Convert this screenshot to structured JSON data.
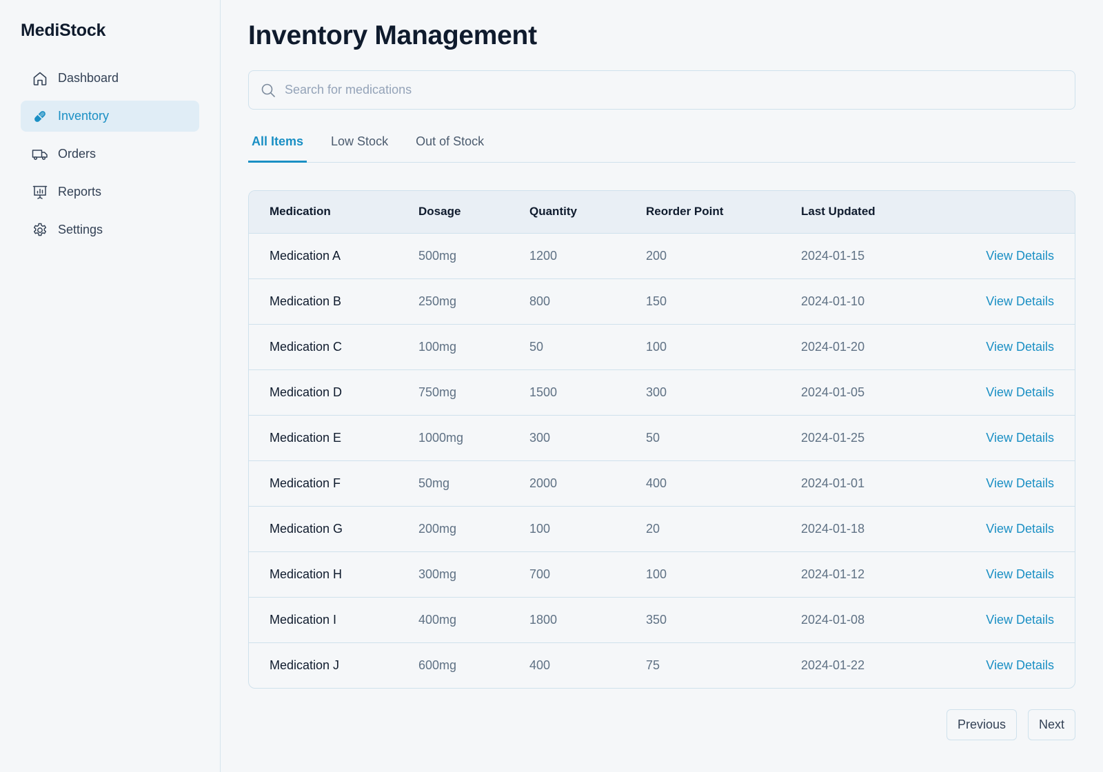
{
  "app": {
    "name": "MediStock"
  },
  "sidebar": {
    "items": [
      {
        "label": "Dashboard",
        "icon": "home-icon",
        "active": false
      },
      {
        "label": "Inventory",
        "icon": "pill-icon",
        "active": true
      },
      {
        "label": "Orders",
        "icon": "truck-icon",
        "active": false
      },
      {
        "label": "Reports",
        "icon": "presentation-chart-icon",
        "active": false
      },
      {
        "label": "Settings",
        "icon": "gear-icon",
        "active": false
      }
    ]
  },
  "main": {
    "title": "Inventory Management",
    "search": {
      "placeholder": "Search for medications",
      "value": ""
    },
    "tabs": [
      {
        "label": "All Items",
        "active": true
      },
      {
        "label": "Low Stock",
        "active": false
      },
      {
        "label": "Out of Stock",
        "active": false
      }
    ],
    "table": {
      "columns": [
        "Medication",
        "Dosage",
        "Quantity",
        "Reorder Point",
        "Last Updated",
        ""
      ],
      "rows": [
        {
          "medication": "Medication A",
          "dosage": "500mg",
          "quantity": "1200",
          "reorder": "200",
          "updated": "2024-01-15",
          "action": "View Details"
        },
        {
          "medication": "Medication B",
          "dosage": "250mg",
          "quantity": "800",
          "reorder": "150",
          "updated": "2024-01-10",
          "action": "View Details"
        },
        {
          "medication": "Medication C",
          "dosage": "100mg",
          "quantity": "50",
          "reorder": "100",
          "updated": "2024-01-20",
          "action": "View Details"
        },
        {
          "medication": "Medication D",
          "dosage": "750mg",
          "quantity": "1500",
          "reorder": "300",
          "updated": "2024-01-05",
          "action": "View Details"
        },
        {
          "medication": "Medication E",
          "dosage": "1000mg",
          "quantity": "300",
          "reorder": "50",
          "updated": "2024-01-25",
          "action": "View Details"
        },
        {
          "medication": "Medication F",
          "dosage": "50mg",
          "quantity": "2000",
          "reorder": "400",
          "updated": "2024-01-01",
          "action": "View Details"
        },
        {
          "medication": "Medication G",
          "dosage": "200mg",
          "quantity": "100",
          "reorder": "20",
          "updated": "2024-01-18",
          "action": "View Details"
        },
        {
          "medication": "Medication H",
          "dosage": "300mg",
          "quantity": "700",
          "reorder": "100",
          "updated": "2024-01-12",
          "action": "View Details"
        },
        {
          "medication": "Medication I",
          "dosage": "400mg",
          "quantity": "1800",
          "reorder": "350",
          "updated": "2024-01-08",
          "action": "View Details"
        },
        {
          "medication": "Medication J",
          "dosage": "600mg",
          "quantity": "400",
          "reorder": "75",
          "updated": "2024-01-22",
          "action": "View Details"
        }
      ]
    },
    "pagination": {
      "previous_label": "Previous",
      "next_label": "Next"
    }
  },
  "colors": {
    "accent": "#1a8fc4",
    "active_bg": "#e0edf6",
    "border": "#cfe1ec",
    "header_bg": "#e9eff5",
    "page_bg": "#f5f7f9"
  }
}
